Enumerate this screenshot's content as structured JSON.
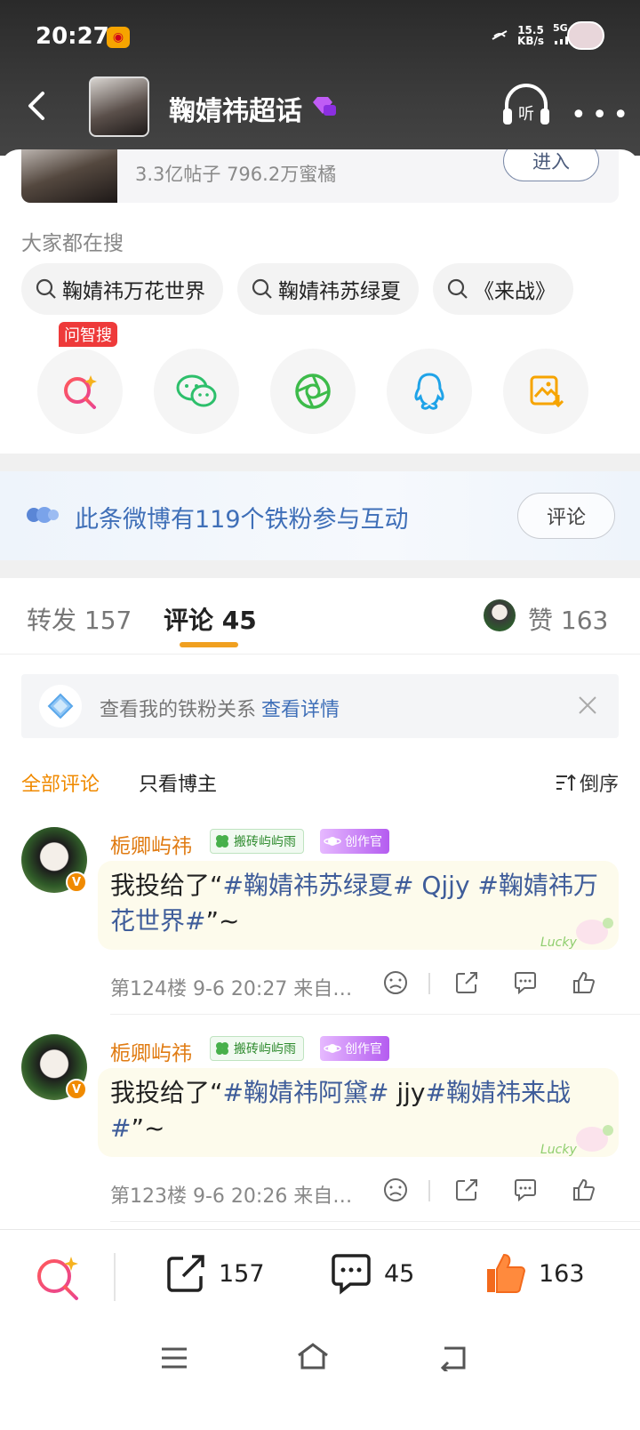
{
  "status": {
    "time": "20:27",
    "net_speed_value": "15.5",
    "net_speed_unit": "KB/s",
    "network": "5G"
  },
  "nav": {
    "title": "鞠婧祎超话"
  },
  "topic_card": {
    "stats": "3.3亿帖子 796.2万蜜橘",
    "enter_label": "进入"
  },
  "search": {
    "heading": "大家都在搜",
    "tags": [
      "鞠婧祎万花世界",
      "鞠婧祎苏绿夏",
      "《来战》"
    ]
  },
  "share": {
    "zhisou_badge": "问智搜"
  },
  "fans_banner": {
    "text": "此条微博有119个铁粉参与互动",
    "button": "评论"
  },
  "tabs": {
    "repost": {
      "label": "转发",
      "count": "157"
    },
    "comment": {
      "label": "评论",
      "count": "45"
    },
    "like": {
      "label": "赞",
      "count": "163"
    }
  },
  "ironfan": {
    "text": "查看我的铁粉关系",
    "link": "查看详情"
  },
  "filters": {
    "all": "全部评论",
    "owner_only": "只看博主",
    "sort": "倒序"
  },
  "comments": [
    {
      "name": "栀卿屿祎",
      "badge1": "搬砖屿屿雨",
      "badge2": "创作官",
      "text_prefix": "我投给了“",
      "text_hl1": "#鞠婧祎苏绿夏#",
      "text_mid": " ",
      "text_hl2": "Qjjy #鞠婧祎万花世界#",
      "text_suffix": "”~",
      "meta": "第124楼 9-6 20:27 来自…"
    },
    {
      "name": "栀卿屿祎",
      "badge1": "搬砖屿屿雨",
      "badge2": "创作官",
      "text_prefix": "我投给了“",
      "text_hl1": "#鞠婧祎阿黛#",
      "text_mid": " jjy",
      "text_hl2": "#鞠婧祎来战#",
      "text_suffix": "”~",
      "meta": "第123楼 9-6 20:26 来自…"
    }
  ],
  "bottom_bar": {
    "repost_count": "157",
    "comment_count": "45",
    "like_count": "163"
  },
  "colors": {
    "accent_orange": "#f08a00",
    "link_blue": "#3f6fb8",
    "like_orange": "#f36a1c"
  }
}
